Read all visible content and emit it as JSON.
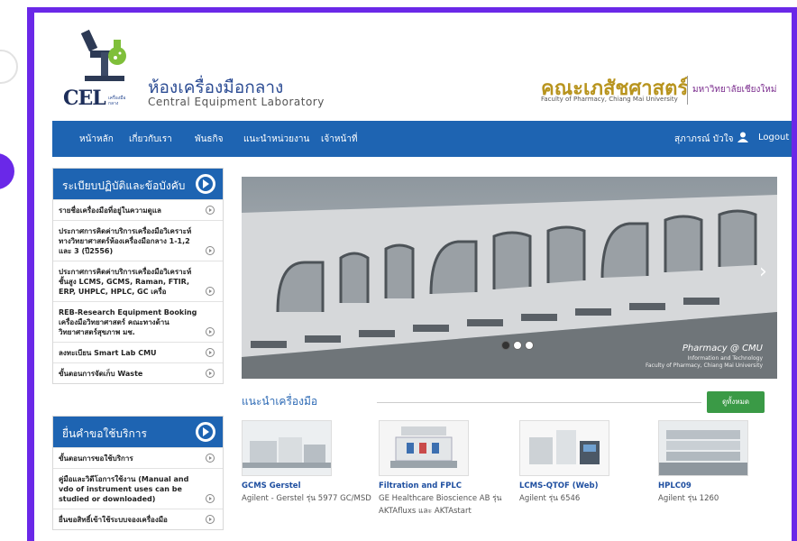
{
  "header": {
    "logo_text": "CEL",
    "logo_small_text": "เครื่องมือ กลาง",
    "site_title_th": "ห้องเครื่องมือกลาง",
    "site_title_en": "Central Equipment Laboratory",
    "faculty_th": "คณะเภสัชศาสตร์",
    "faculty_en": "Faculty of Pharmacy, Chiang Mai University",
    "university_th": "มหาวิทยาลัยเชียงใหม่"
  },
  "nav": {
    "items": [
      {
        "label": "หน้าหลัก"
      },
      {
        "label": "เกี่ยวกับเรา"
      },
      {
        "label": "พันธกิจ"
      },
      {
        "label": "แนะนำหน่วยงาน"
      },
      {
        "label": "เจ้าหน้าที่"
      }
    ],
    "user_name": "สุภาภรณ์ บัวใจ",
    "user_icon": "user-icon",
    "logout_label": "Logout"
  },
  "sidebar_rules": {
    "title": "ระเบียบปฏิบัติและข้อบังคับ",
    "items": [
      {
        "label": "รายชื่อเครื่องมือที่อยู่ในความดูแล"
      },
      {
        "label": "ประกาศการคิดค่าบริการเครื่องมือวิเคราะห์ทางวิทยาศาสตร์ห้องเครื่องมือกลาง 1-1,2 และ 3 (ปี2556)"
      },
      {
        "label": "ประกาศการคิดค่าบริการเครื่องมือวิเคราะห์ชั้นสูง LCMS, GCMS, Raman, FTIR, ERP, UHPLC, HPLC, GC เครื่อ"
      },
      {
        "label": "REB-Research Equipment Booking เครื่องมือวิทยาศาสตร์ คณะทางด้านวิทยาศาสตร์สุขภาพ มช."
      },
      {
        "label": "ลงทะเบียน Smart Lab CMU"
      },
      {
        "label": "ขั้นตอนการจัดเก็บ Waste"
      }
    ]
  },
  "sidebar_service": {
    "title": "ยื่นคำขอใช้บริการ",
    "items": [
      {
        "label": "ขั้นตอนการขอใช้บริการ"
      },
      {
        "label": "คู่มือและวิดีโอการใช้งาน (Manual and vdo of instrument uses can be studied or downloaded)"
      },
      {
        "label": "ยื่นขอสิทธิ์เข้าใช้ระบบจองเครื่องมือ"
      }
    ]
  },
  "slider": {
    "brand": "Pharmacy @ CMU",
    "subtitle_1": "Information and Technology",
    "subtitle_2": "Faculty of Pharmacy, Chiang Mai University"
  },
  "equipment_section": {
    "title": "แนะนำเครื่องมือ",
    "view_all_label": "ดูทั้งหมด",
    "items": [
      {
        "name": "GCMS Gerstel",
        "desc": "Agilent - Gerstel รุ่น 5977 GC/MSD"
      },
      {
        "name": "Filtration and FPLC",
        "desc": "GE Healthcare Bioscience AB รุ่น AKTAfluxs และ AKTAstart"
      },
      {
        "name": "LCMS-QTOF (Web)",
        "desc": "Agilent รุ่น 6546"
      },
      {
        "name": "HPLC09",
        "desc": "Agilent รุ่น 1260"
      }
    ]
  },
  "colors": {
    "frame": "#6a28e8",
    "nav": "#1e64b2",
    "button_green": "#3a9a46",
    "faculty_gold": "#b8941e"
  }
}
